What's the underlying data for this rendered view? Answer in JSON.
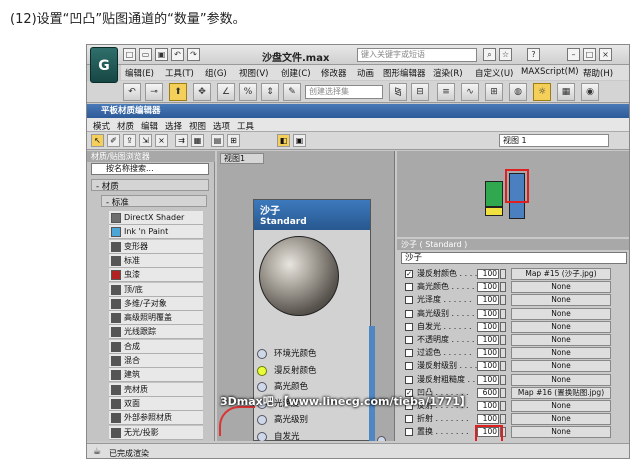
{
  "caption": "(12)设置“凹凸”贴图通道的“数量”参数。",
  "app": {
    "logo": "G",
    "title": "沙盘文件.max",
    "search_placeholder": "键入关键字或短语",
    "menu": [
      "编辑(E)",
      "工具(T)",
      "组(G)",
      "视图(V)",
      "创建(C)",
      "修改器",
      "动画",
      "图形编辑器",
      "渲染(R)",
      "自定义(U)",
      "MAXScript(M)",
      "帮助(H)"
    ],
    "selection_set_placeholder": "创建选择集"
  },
  "slate": {
    "title": "平板材质编辑器",
    "menu": [
      "模式",
      "材质",
      "编辑",
      "选择",
      "视图",
      "选项",
      "工具"
    ],
    "view_select": "视图 1"
  },
  "browser": {
    "title": "材质/贴图浏览器",
    "search": "按名称搜索...",
    "group_materials": "- 材质",
    "group_standard": "- 标准",
    "items": [
      {
        "label": "DirectX Shader",
        "color": "#6d6d6d"
      },
      {
        "label": "Ink 'n Paint",
        "color": "#4ea6d8"
      },
      {
        "label": "变形器",
        "color": "#555555"
      },
      {
        "label": "标准",
        "color": "#555555"
      },
      {
        "label": "虫漆",
        "color": "#b22222"
      },
      {
        "label": "顶/底",
        "color": "#555555"
      },
      {
        "label": "多维/子对象",
        "color": "#555555"
      },
      {
        "label": "高级照明覆盖",
        "color": "#555555"
      },
      {
        "label": "光线跟踪",
        "color": "#555555"
      },
      {
        "label": "合成",
        "color": "#555555"
      },
      {
        "label": "混合",
        "color": "#555555"
      },
      {
        "label": "建筑",
        "color": "#555555"
      },
      {
        "label": "壳材质",
        "color": "#555555"
      },
      {
        "label": "双面",
        "color": "#555555"
      },
      {
        "label": "外部参照材质",
        "color": "#555555"
      },
      {
        "label": "无光/投影",
        "color": "#555555"
      }
    ]
  },
  "nodeview": {
    "tab": "视图1",
    "node_name": "沙子",
    "node_type": "Standard",
    "slots": [
      "环境光颜色",
      "漫反射颜色",
      "高光颜色",
      "光泽度",
      "高光级别",
      "自发光"
    ]
  },
  "params": {
    "title": "沙子 ( Standard )",
    "material_name": "沙子",
    "rows": [
      {
        "checked": true,
        "label": "漫反射颜色 . . . .",
        "amount": "100",
        "map": "Map #15 (沙子.jpg)"
      },
      {
        "checked": false,
        "label": "高光颜色 . . . . .",
        "amount": "100",
        "map": "None"
      },
      {
        "checked": false,
        "label": "光泽度 . . . . . .",
        "amount": "100",
        "map": "None"
      },
      {
        "checked": false,
        "label": "高光级别 . . . . .",
        "amount": "100",
        "map": "None"
      },
      {
        "checked": false,
        "label": "自发光 . . . . . .",
        "amount": "100",
        "map": "None"
      },
      {
        "checked": false,
        "label": "不透明度 . . . . .",
        "amount": "100",
        "map": "None"
      },
      {
        "checked": false,
        "label": "过滤色 . . . . . .",
        "amount": "100",
        "map": "None"
      },
      {
        "checked": false,
        "label": "漫反射级别 . . . .",
        "amount": "100",
        "map": "None"
      },
      {
        "checked": false,
        "label": "漫反射粗糙度 . . .",
        "amount": "100",
        "map": "None"
      },
      {
        "checked": true,
        "label": "凹凸 . . . . . . .",
        "amount": "600",
        "map": "Map #16 (置换贴图.jpg)"
      },
      {
        "checked": false,
        "label": "反射 . . . . . . .",
        "amount": "100",
        "map": "None"
      },
      {
        "checked": false,
        "label": "折射 . . . . . . .",
        "amount": "100",
        "map": "None"
      },
      {
        "checked": false,
        "label": "置换 . . . . . . .",
        "amount": "100",
        "map": "None"
      }
    ]
  },
  "status": "已完成渲染",
  "watermark_text": "3Dmax吧  【www.linecg.com/tieba/1771】"
}
